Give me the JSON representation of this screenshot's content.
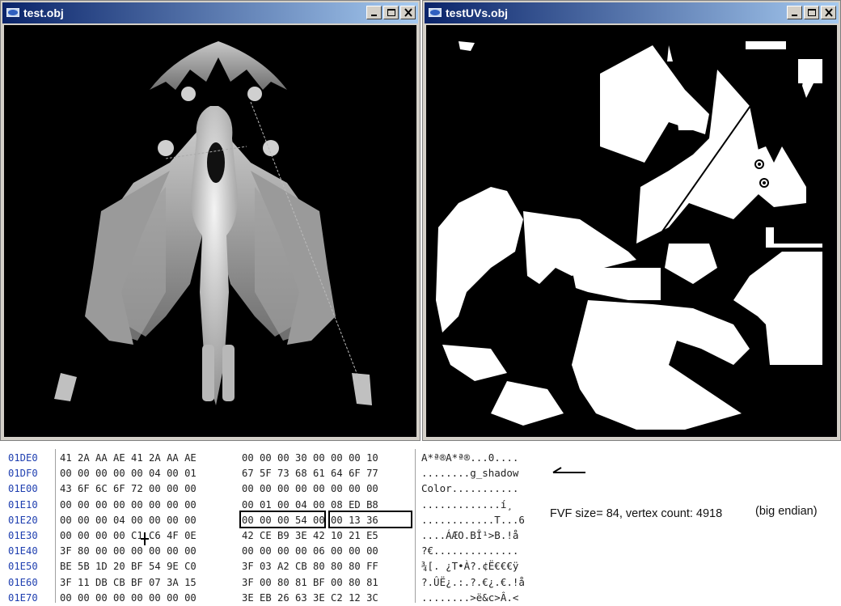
{
  "left_window": {
    "title": "test.obj",
    "viewport_content": "3d-model-render"
  },
  "right_window": {
    "title": "testUVs.obj",
    "viewport_content": "uv-map-render"
  },
  "window_buttons": [
    "minimize",
    "maximize",
    "close"
  ],
  "hex_dump": {
    "rows": [
      {
        "addr": "01DE0",
        "hex_a": "41 2A AA AE 41 2A AA AE",
        "hex_b": "00 00 00 30 00 00 00 10",
        "ascii": "A*ª®A*ª®...0...."
      },
      {
        "addr": "01DF0",
        "hex_a": "00 00 00 00 00 04 00 01",
        "hex_b": "67 5F 73 68 61 64 6F 77",
        "ascii": "........g_shadow"
      },
      {
        "addr": "01E00",
        "hex_a": "43 6F 6C 6F 72 00 00 00",
        "hex_b": "00 00 00 00 00 00 00 00",
        "ascii": "Color..........."
      },
      {
        "addr": "01E10",
        "hex_a": "00 00 00 00 00 00 00 00",
        "hex_b": "00 01 00 04 00 08 ED B8",
        "ascii": ".............í¸"
      },
      {
        "addr": "01E20",
        "hex_a": "00 00 00 04 00 00 00 00",
        "hex_b": "00 00 00 54 00 00 13 36",
        "ascii": "............T...6"
      },
      {
        "addr": "01E30",
        "hex_a": "00 00 00 00 C1 C6 4F 0E",
        "hex_b": "42 CE B9 3E 42 10 21 E5",
        "ascii": "....ÁÆO.BÎ¹>B.!å"
      },
      {
        "addr": "01E40",
        "hex_a": "3F 80 00 00 00 00 00 00",
        "hex_b": "00 00 00 00 06 00 00 00",
        "ascii": "?€.............."
      },
      {
        "addr": "01E50",
        "hex_a": "BE 5B 1D 20 BF 54 9E C0",
        "hex_b": "3F 03 A2 CB 80 80 80 FF",
        "ascii": "¾[. ¿T•À?.¢Ë€€€ÿ"
      },
      {
        "addr": "01E60",
        "hex_a": "3F 11 DB CB BF 07 3A 15",
        "hex_b": "3F 00 80 81 BF 00 80 81",
        "ascii": "?.ÛË¿.:.?.€¿.€.!å"
      },
      {
        "addr": "01E70",
        "hex_a": "00 00 00 00 00 00 00 00",
        "hex_b": "3E EB 26 63 3E C2 12 3C",
        "ascii": "........>ë&c>Â.<"
      }
    ]
  },
  "annotations": {
    "fvf_text": "FVF size= 84, vertex count: 4918",
    "endian_text": "(big endian)",
    "arrow_icon": "left-arrow-icon"
  },
  "colors": {
    "titlebar_start": "#0a246a",
    "titlebar_end": "#a6caf0",
    "address": "#1f3fb0"
  }
}
